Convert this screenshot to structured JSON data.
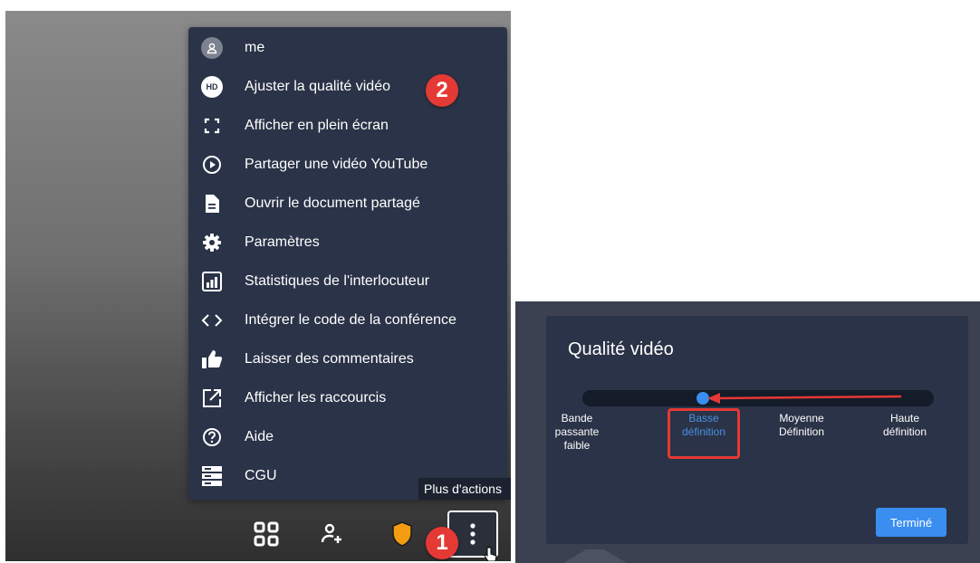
{
  "menu": {
    "items": [
      {
        "label": "me",
        "icon": "avatar-icon"
      },
      {
        "label": "Ajuster la qualité vidéo",
        "icon": "hd-icon",
        "badge": "HD"
      },
      {
        "label": "Afficher en plein écran",
        "icon": "fullscreen-icon"
      },
      {
        "label": "Partager une vidéo YouTube",
        "icon": "play-circle-icon"
      },
      {
        "label": "Ouvrir le document partagé",
        "icon": "document-icon"
      },
      {
        "label": "Paramètres",
        "icon": "gear-icon"
      },
      {
        "label": "Statistiques de l'interlocuteur",
        "icon": "stats-icon"
      },
      {
        "label": "Intégrer le code de la conférence",
        "icon": "code-icon"
      },
      {
        "label": "Laisser des commentaires",
        "icon": "thumbs-up-icon"
      },
      {
        "label": "Afficher les raccourcis",
        "icon": "external-link-icon"
      },
      {
        "label": "Aide",
        "icon": "help-icon"
      },
      {
        "label": "CGU",
        "icon": "server-icon"
      }
    ]
  },
  "steps": {
    "one": "1",
    "two": "2"
  },
  "tooltip": "Plus d'actions",
  "toolbar": {
    "icons": [
      "grid-icon",
      "add-user-icon",
      "shield-icon",
      "more-vertical-icon"
    ]
  },
  "quality_dialog": {
    "title": "Qualité vidéo",
    "options": [
      {
        "label": "Bande passante faible",
        "lines": [
          "Bande",
          "passante",
          "faible"
        ]
      },
      {
        "label": "Basse définition",
        "lines": [
          "Basse",
          "définition"
        ],
        "selected": true
      },
      {
        "label": "Moyenne Définition",
        "lines": [
          "Moyenne",
          "Définition"
        ]
      },
      {
        "label": "Haute définition",
        "lines": [
          "Haute",
          "définition"
        ]
      }
    ],
    "done_label": "Terminé"
  },
  "colors": {
    "menu_bg": "#2a3347",
    "accent": "#3a8ef0",
    "step_badge": "#e53935",
    "shield": "#f39c12"
  }
}
